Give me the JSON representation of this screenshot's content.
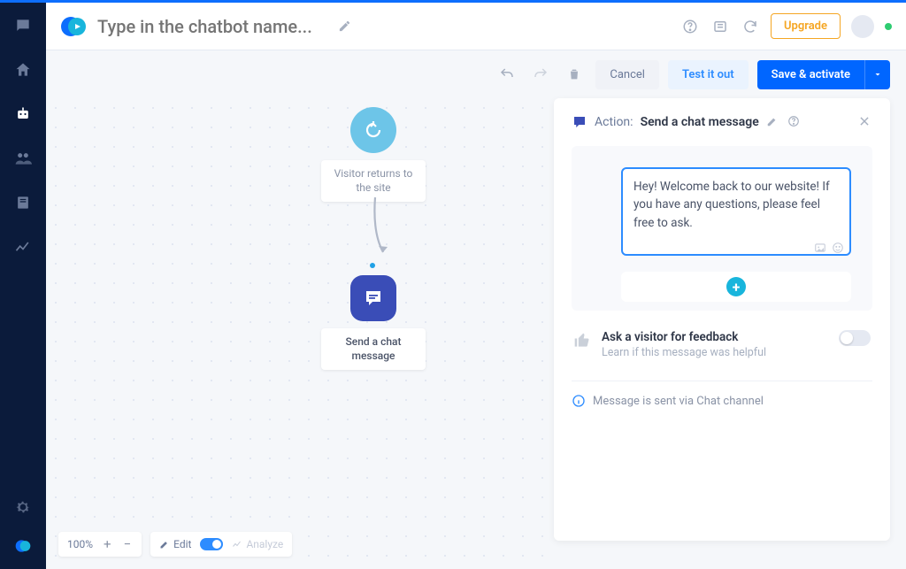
{
  "header": {
    "title_placeholder": "Type in the chatbot name...",
    "upgrade_label": "Upgrade"
  },
  "actionbar": {
    "cancel": "Cancel",
    "test": "Test it out",
    "save": "Save & activate"
  },
  "canvas": {
    "node1_label": "Visitor returns to the site",
    "node2_label": "Send a chat message"
  },
  "panel": {
    "action_prefix": "Action:",
    "action_name": "Send a chat message",
    "message_text": "Hey! Welcome back to our website! If you have any questions, please feel free to ask.",
    "feedback_title": "Ask a visitor for feedback",
    "feedback_sub": "Learn if this message was helpful",
    "info_text": "Message is sent via Chat channel"
  },
  "bottombar": {
    "zoom": "100%",
    "edit": "Edit",
    "analyze": "Analyze"
  }
}
